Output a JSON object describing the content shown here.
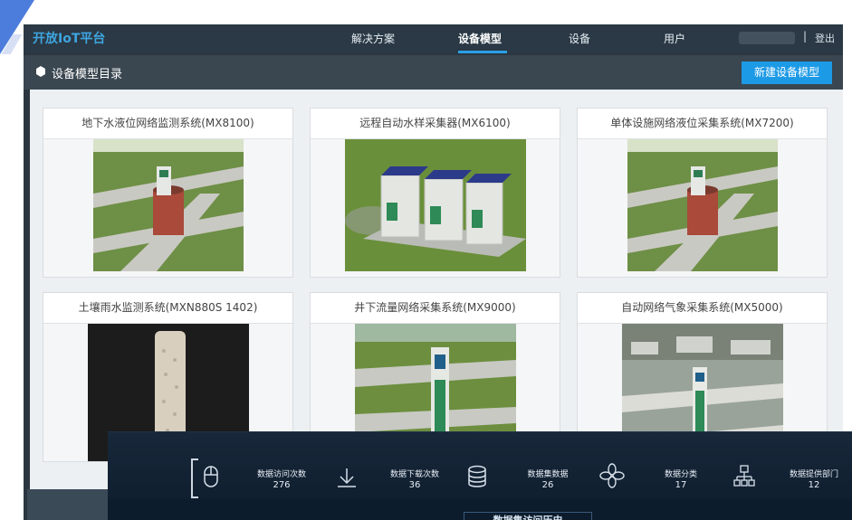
{
  "nav": {
    "brand": "开放IoT平台",
    "items": [
      "解决方案",
      "设备模型",
      "设备",
      "用户"
    ],
    "separator": "|",
    "logout": "登出"
  },
  "subheader": {
    "title": "设备模型目录",
    "new_button": "新建设备模型"
  },
  "cards": [
    {
      "title": "地下水液位网络监测系统(MX8100)"
    },
    {
      "title": "远程自动水样采集器(MX6100)"
    },
    {
      "title": "单体设施网络液位采集系统(MX7200)"
    },
    {
      "title": "土壤雨水监测系统(MXN880S 1402)"
    },
    {
      "title": "井下流量网络采集系统(MX9000)"
    },
    {
      "title": "自动网络气象采集系统(MX5000)"
    }
  ],
  "stats": {
    "items": [
      {
        "label": "数据访问次数",
        "value": "276",
        "icon": "mouse-icon"
      },
      {
        "label": "数据下载次数",
        "value": "36",
        "icon": "download-icon"
      },
      {
        "label": "数据集数据",
        "value": "26",
        "icon": "database-icon"
      },
      {
        "label": "数据分类",
        "value": "17",
        "icon": "category-icon"
      },
      {
        "label": "数据提供部门",
        "value": "12",
        "icon": "org-tree-icon"
      }
    ],
    "history_title": "数据集访问历史"
  },
  "colors": {
    "accent": "#1d9ae6",
    "brand": "#3fa5e0",
    "nav_bg": "#2a3945",
    "subbar_bg": "#3a4650",
    "stats_bg": "#0d1c2c"
  }
}
